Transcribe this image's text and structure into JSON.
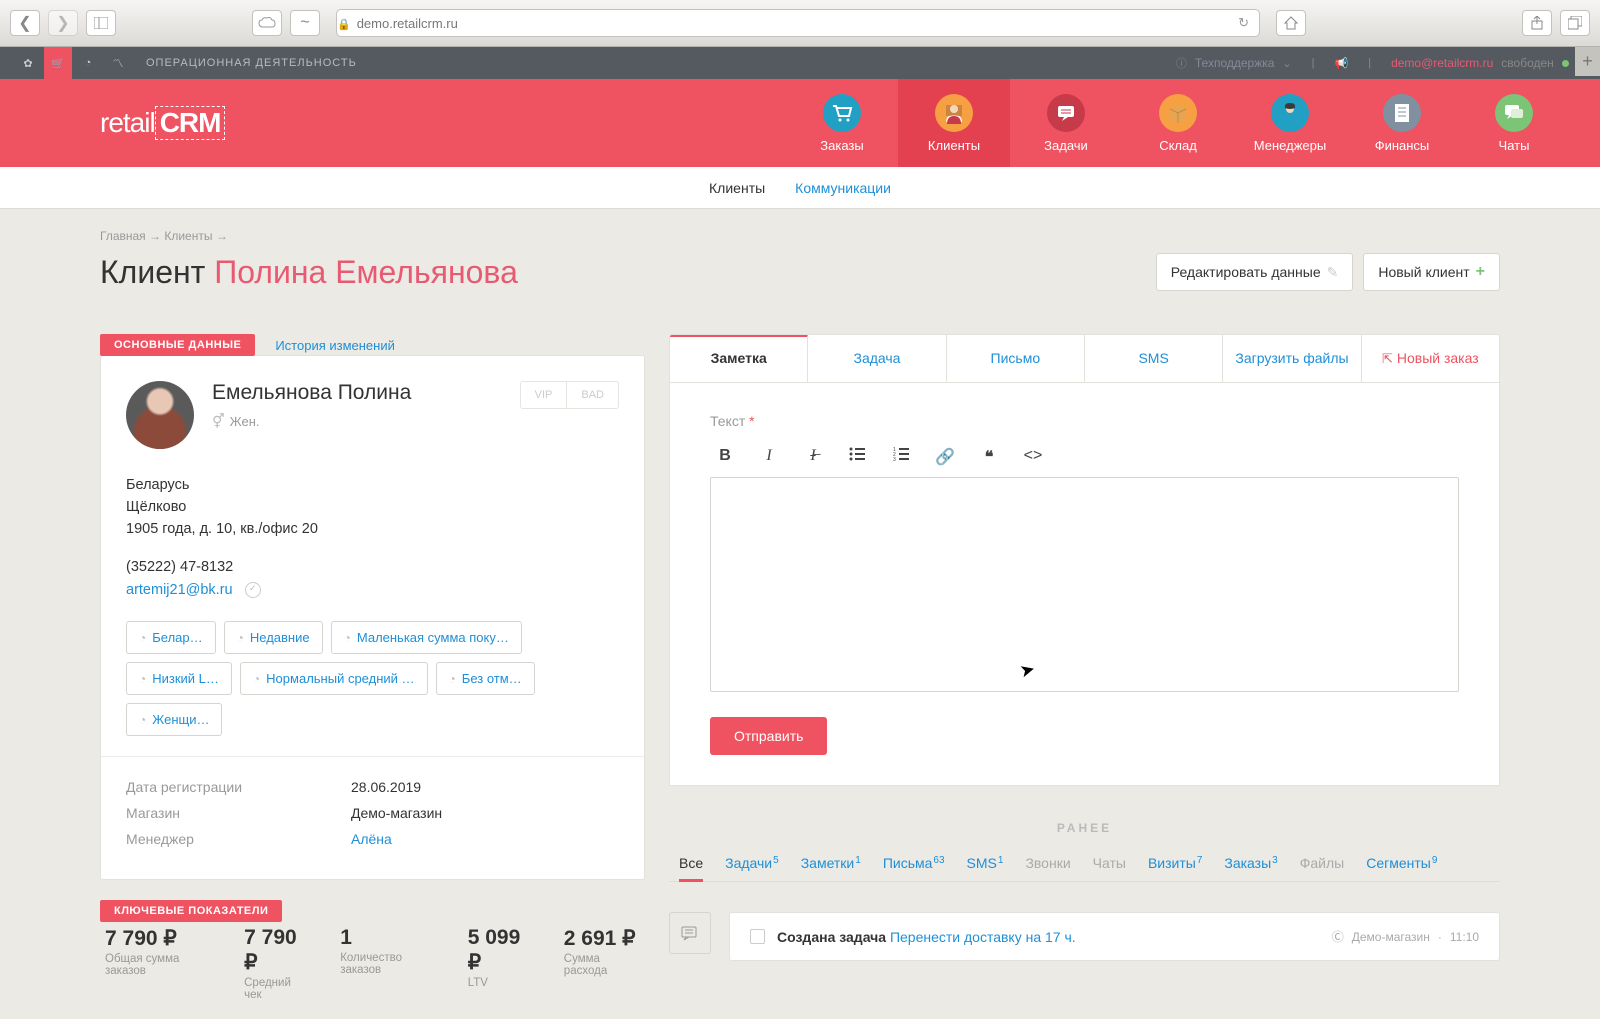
{
  "browser": {
    "url": "demo.retailcrm.ru"
  },
  "util": {
    "operations": "ОПЕРАЦИОННАЯ ДЕЯТЕЛЬНОСТЬ",
    "support": "Техподдержка",
    "email": "demo@retailcrm.ru",
    "status": "свободен"
  },
  "logo": {
    "part1": "retail",
    "part2": "CRM"
  },
  "nav": [
    {
      "label": "Заказы"
    },
    {
      "label": "Клиенты"
    },
    {
      "label": "Задачи"
    },
    {
      "label": "Склад"
    },
    {
      "label": "Менеджеры"
    },
    {
      "label": "Финансы"
    },
    {
      "label": "Чаты"
    }
  ],
  "subnav": {
    "clients": "Клиенты",
    "comm": "Коммуникации"
  },
  "breadcrumb": {
    "home": "Главная",
    "clients": "Клиенты"
  },
  "page": {
    "title_prefix": "Клиент ",
    "client_name": "Полина Емельянова",
    "edit": "Редактировать данные",
    "new": "Новый клиент"
  },
  "sections": {
    "main": "ОСНОВНЫЕ ДАННЫЕ",
    "history": "История изменений",
    "kpi": "КЛЮЧЕВЫЕ ПОКАЗАТЕЛИ"
  },
  "client": {
    "fullname": "Емельянова Полина",
    "gender": "Жен.",
    "vip": "VIP",
    "bad": "BAD",
    "country": "Беларусь",
    "city": "Щёлково",
    "address": "1905 года, д. 10, кв./офис 20",
    "phone": "(35222) 47-8132",
    "email": "artemij21@bk.ru"
  },
  "tags": [
    "Белар…",
    "Недавние",
    "Маленькая сумма поку…",
    "Низкий L…",
    "Нормальный средний …",
    "Без отм…",
    "Женщи…"
  ],
  "meta": {
    "reg_label": "Дата регистрации",
    "reg_value": "28.06.2019",
    "shop_label": "Магазин",
    "shop_value": "Демо-магазин",
    "manager_label": "Менеджер",
    "manager_value": "Алёна"
  },
  "kpi": [
    {
      "val": "7 790 ₽",
      "label": "Общая сумма заказов"
    },
    {
      "val": "7 790 ₽",
      "label": "Средний чек"
    },
    {
      "val": "1",
      "label": "Количество заказов"
    },
    {
      "val": "5 099 ₽",
      "label": "LTV"
    },
    {
      "val": "2 691 ₽",
      "label": "Сумма расхода"
    }
  ],
  "tabs": {
    "note": "Заметка",
    "task": "Задача",
    "letter": "Письмо",
    "sms": "SMS",
    "upload": "Загрузить файлы",
    "neworder": "Новый заказ"
  },
  "editor": {
    "text_label": "Текст",
    "submit": "Отправить"
  },
  "earlier": "РАНЕЕ",
  "filters": [
    {
      "label": "Все",
      "count": ""
    },
    {
      "label": "Задачи",
      "count": "5"
    },
    {
      "label": "Заметки",
      "count": "1"
    },
    {
      "label": "Письма",
      "count": "63"
    },
    {
      "label": "SMS",
      "count": "1"
    },
    {
      "label": "Звонки",
      "count": ""
    },
    {
      "label": "Чаты",
      "count": ""
    },
    {
      "label": "Визиты",
      "count": "7"
    },
    {
      "label": "Заказы",
      "count": "3"
    },
    {
      "label": "Файлы",
      "count": ""
    },
    {
      "label": "Сегменты",
      "count": "9"
    }
  ],
  "timeline": {
    "task_prefix": "Создана задача ",
    "task_link": "Перенести доставку на 17 ч.",
    "shop": "Демо-магазин",
    "time": "11:10"
  }
}
